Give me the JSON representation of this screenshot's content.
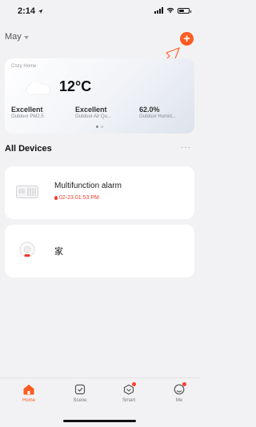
{
  "status_bar": {
    "time": "2:14"
  },
  "header": {
    "home_name": "May",
    "add_symbol": "+"
  },
  "weather": {
    "home_label": "Cozy Home",
    "temperature": "12°C",
    "stats": [
      {
        "value": "Excellent",
        "label": "Outdoor PM2.5"
      },
      {
        "value": "Excellent",
        "label": "Outdoor Air Qu..."
      },
      {
        "value": "62.0%",
        "label": "Outdoor Humid..."
      }
    ]
  },
  "devices_section": {
    "title": "All Devices",
    "more": "···"
  },
  "devices": [
    {
      "name": "Multifunction alarm",
      "status": "02-23 01:53 PM",
      "icon": "alarm-device-icon"
    },
    {
      "name": "家",
      "icon": "sensor-device-icon"
    }
  ],
  "tabs": [
    {
      "label": "Home",
      "icon": "home-icon",
      "active": true
    },
    {
      "label": "Scene",
      "icon": "scene-icon"
    },
    {
      "label": "Smart",
      "icon": "smart-icon",
      "badge": true
    },
    {
      "label": "Me",
      "icon": "me-icon",
      "badge": true
    }
  ],
  "colors": {
    "accent": "#ff5b22",
    "alert": "#ef3b2d",
    "background": "#f2f2f4"
  }
}
